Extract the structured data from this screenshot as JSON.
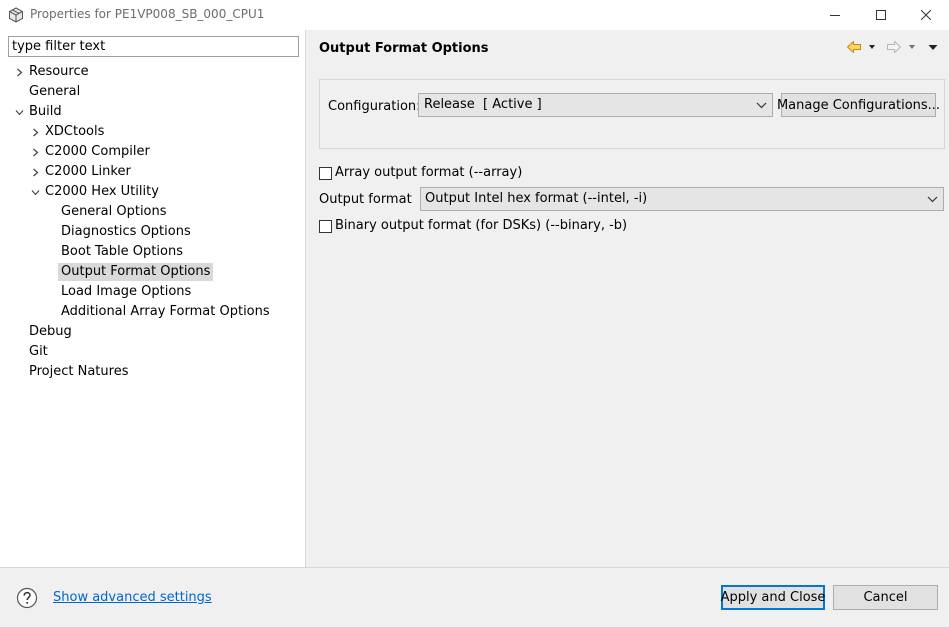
{
  "window": {
    "title": "Properties for PE1VP008_SB_000_CPU1",
    "icon": "package-icon",
    "controls": [
      "minimize-icon",
      "maximize-icon",
      "close-icon"
    ]
  },
  "filter": {
    "placeholder": "type filter text"
  },
  "tree": {
    "items": [
      {
        "label": "Resource",
        "state": "collapsed"
      },
      {
        "label": "General",
        "state": "leaf"
      },
      {
        "label": "Build",
        "state": "expanded"
      },
      {
        "label": "XDCtools",
        "state": "collapsed"
      },
      {
        "label": "C2000 Compiler",
        "state": "collapsed"
      },
      {
        "label": "C2000 Linker",
        "state": "collapsed"
      },
      {
        "label": "C2000 Hex Utility",
        "state": "expanded"
      },
      {
        "label": "General Options",
        "state": "leaf"
      },
      {
        "label": "Diagnostics Options",
        "state": "leaf"
      },
      {
        "label": "Boot Table Options",
        "state": "leaf"
      },
      {
        "label": "Output Format Options",
        "state": "leaf",
        "selected": true
      },
      {
        "label": "Load Image Options",
        "state": "leaf"
      },
      {
        "label": "Additional Array Format Options",
        "state": "leaf"
      },
      {
        "label": "Debug",
        "state": "leaf"
      },
      {
        "label": "Git",
        "state": "leaf"
      },
      {
        "label": "Project Natures",
        "state": "leaf"
      }
    ]
  },
  "page": {
    "title": "Output Format Options",
    "nav_icons": [
      "back-arrow-icon",
      "forward-arrow-icon",
      "view-menu-icon"
    ],
    "configuration": {
      "label": "Configuration:",
      "value": "Release  [ Active ]",
      "manage_label": "Manage Configurations..."
    },
    "array_output": {
      "label": "Array output format (--array)",
      "checked": false
    },
    "output_format": {
      "label": "Output format",
      "value": "Output Intel hex format (--intel, -i)"
    },
    "binary_output": {
      "label": "Binary output format (for DSKs) (--binary, -b)",
      "checked": false
    }
  },
  "footer": {
    "help_icon": "help-icon",
    "advanced_link": "Show advanced settings",
    "apply_label": "Apply and Close",
    "cancel_label": "Cancel"
  },
  "colors": {
    "link": "#0066cc",
    "default_button_border": "#0078d7",
    "nav_back_arrow": "#e8a60b",
    "selection": "#d9d9d9",
    "dialog_background": "#f0f0f0"
  }
}
